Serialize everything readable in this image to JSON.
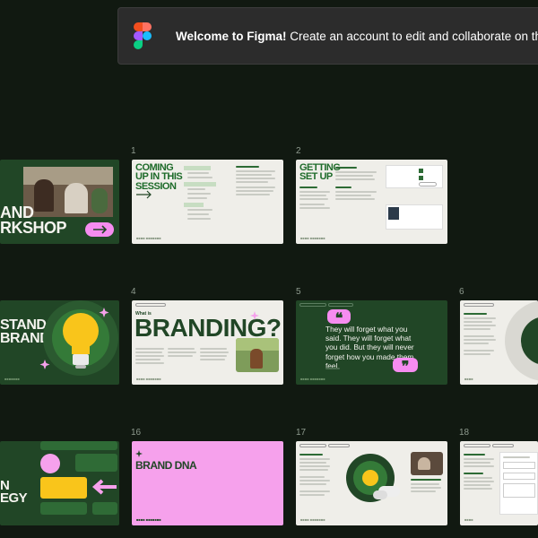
{
  "banner": {
    "bold": "Welcome to Figma!",
    "text": " Create an account to edit and collaborate on th"
  },
  "slides": {
    "s0": {
      "title1": "AND",
      "title2": "RKSHOP"
    },
    "s1": {
      "number": "1",
      "title": "COMING UP IN THIS SESSION"
    },
    "s2": {
      "number": "2",
      "title": "GETTING SET UP"
    },
    "s3": {
      "title1": "STAND",
      "title2": "BRAND"
    },
    "s4": {
      "number": "4",
      "small": "What is",
      "title": "BRANDING?"
    },
    "s5": {
      "number": "5",
      "quote": "They will forget what you said. They will forget what you did. But they will never forget how you made them feel."
    },
    "s6": {
      "number": "6"
    },
    "s7": {
      "title1": "N",
      "title2": "EGY"
    },
    "s16": {
      "number": "16",
      "title": "BRAND DNA"
    },
    "s17": {
      "number": "17"
    },
    "s18": {
      "number": "18"
    }
  },
  "colors": {
    "dark_green": "#214626",
    "light": "#efeee9",
    "pink": "#f6a1ec",
    "accent_green": "#1e6b2a",
    "yellow": "#f9c51b"
  }
}
